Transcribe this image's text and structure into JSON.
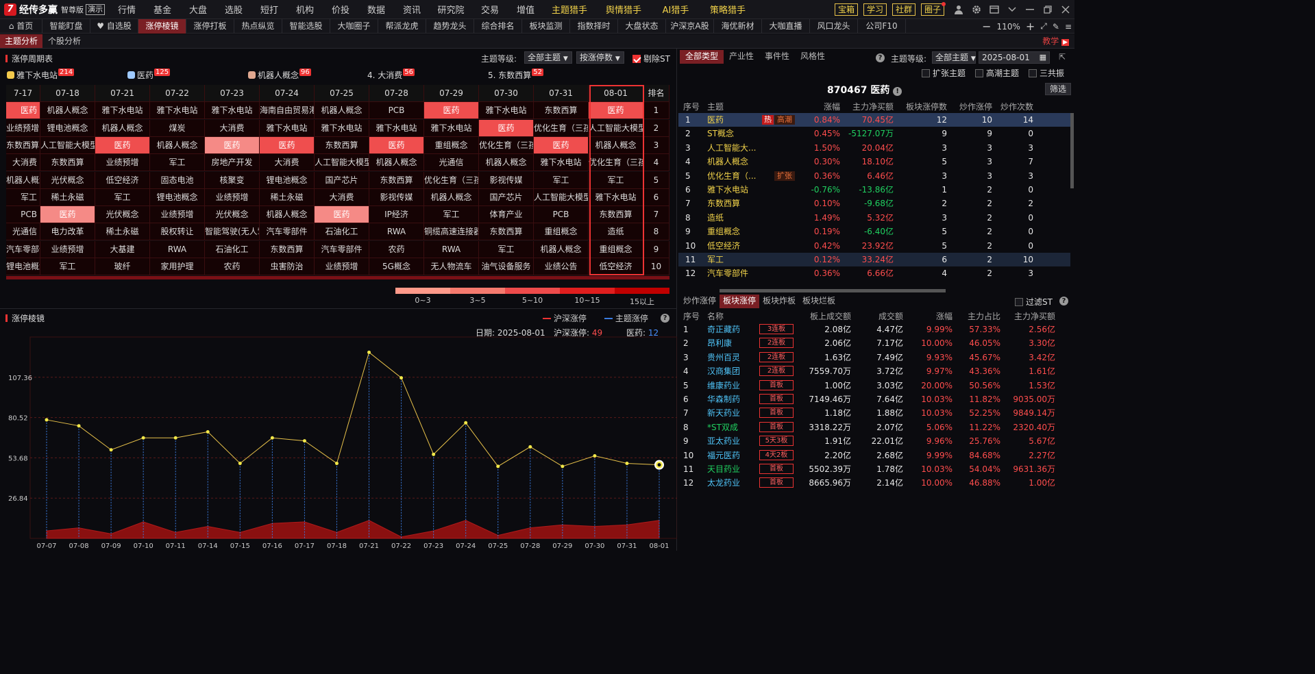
{
  "app": {
    "name": "经传多赢",
    "edition": "智尊版",
    "demo": "演示"
  },
  "menu": [
    {
      "label": "行情",
      "hot": false
    },
    {
      "label": "基金",
      "hot": false
    },
    {
      "label": "大盘",
      "hot": false
    },
    {
      "label": "选股",
      "hot": false
    },
    {
      "label": "短打",
      "hot": false
    },
    {
      "label": "机构",
      "hot": false
    },
    {
      "label": "价投",
      "hot": false
    },
    {
      "label": "数据",
      "hot": false
    },
    {
      "label": "资讯",
      "hot": false
    },
    {
      "label": "研究院",
      "hot": false
    },
    {
      "label": "交易",
      "hot": false
    },
    {
      "label": "增值",
      "hot": false
    },
    {
      "label": "主题猎手",
      "hot": true
    },
    {
      "label": "舆情猎手",
      "hot": true
    },
    {
      "label": "AI猎手",
      "hot": true
    },
    {
      "label": "策略猎手",
      "hot": true
    }
  ],
  "menu_buttons": [
    "宝箱",
    "学习",
    "社群",
    "圈子"
  ],
  "tabs": [
    "首页",
    "智能盯盘",
    "自选股",
    "涨停棱镜",
    "涨停打板",
    "热点纵览",
    "智能选股",
    "大咖圈子",
    "帮派龙虎",
    "趋势龙头",
    "综合排名",
    "板块监测",
    "指数择时",
    "大盘状态",
    "沪深京A股",
    "海优新材",
    "大咖直播",
    "风口龙头",
    "公司F10"
  ],
  "active_tab": "涨停棱镜",
  "zoom": "110%",
  "subtabs": [
    "主题分析",
    "个股分析"
  ],
  "teach": "教学",
  "cycle": {
    "title": "涨停周期表",
    "level_label": "主题等级:",
    "level_value": "全部主题",
    "sort_value": "按涨停数",
    "exclude_st": "剔除ST",
    "topics": [
      {
        "label": "雅下水电站",
        "count": "214",
        "color": "#f2c94c"
      },
      {
        "label": "医药",
        "count": "125",
        "color": "#9ec9ff"
      },
      {
        "label": "机器人概念",
        "count": "96",
        "color": "#e0a890"
      },
      {
        "label": "4. 大消费",
        "count": "56",
        "color": ""
      },
      {
        "label": "5. 东数西算",
        "count": "52",
        "color": ""
      }
    ],
    "dates": [
      "7-17",
      "07-18",
      "07-21",
      "07-22",
      "07-23",
      "07-24",
      "07-25",
      "07-28",
      "07-29",
      "07-30",
      "07-31",
      "08-01"
    ],
    "rank_label": "排名",
    "ranks": [
      "1",
      "2",
      "3",
      "4",
      "5",
      "6",
      "7",
      "8",
      "9",
      "10"
    ],
    "rows": [
      [
        "医药",
        "机器人概念",
        "雅下水电站",
        "雅下水电站",
        "雅下水电站",
        "海南自由贸易港",
        "机器人概念",
        "PCB",
        "医药",
        "雅下水电站",
        "东数西算",
        "医药"
      ],
      [
        "业绩预增",
        "锂电池概念",
        "机器人概念",
        "煤炭",
        "大消费",
        "雅下水电站",
        "雅下水电站",
        "雅下水电站",
        "雅下水电站",
        "医药",
        "优化生育（三孩",
        "人工智能大模型"
      ],
      [
        "东数西算",
        "人工智能大模型",
        "医药",
        "机器人概念",
        "医药",
        "医药",
        "东数西算",
        "医药",
        "重组概念",
        "优化生育（三孩",
        "医药",
        "机器人概念"
      ],
      [
        "大消费",
        "东数西算",
        "业绩预增",
        "军工",
        "房地产开发",
        "大消费",
        "人工智能大模型",
        "机器人概念",
        "光通信",
        "机器人概念",
        "雅下水电站",
        "优化生育（三孩"
      ],
      [
        "机器人概念",
        "光伏概念",
        "低空经济",
        "固态电池",
        "核聚变",
        "锂电池概念",
        "国产芯片",
        "东数西算",
        "优化生育（三孩",
        "影视传媒",
        "军工",
        "军工"
      ],
      [
        "军工",
        "稀土永磁",
        "军工",
        "锂电池概念",
        "业绩预增",
        "稀土永磁",
        "大消费",
        "影视传媒",
        "机器人概念",
        "国产芯片",
        "人工智能大模型",
        "雅下水电站"
      ],
      [
        "PCB",
        "医药",
        "光伏概念",
        "业绩预增",
        "光伏概念",
        "机器人概念",
        "医药",
        "IP经济",
        "军工",
        "体育产业",
        "PCB",
        "东数西算"
      ],
      [
        "光通信",
        "电力改革",
        "稀土永磁",
        "股权转让",
        "智能驾驶(无人驾",
        "汽车零部件",
        "石油化工",
        "RWA",
        "铜缆高速连接器",
        "东数西算",
        "重组概念",
        "造纸"
      ],
      [
        "汽车零部件",
        "业绩预增",
        "大基建",
        "RWA",
        "石油化工",
        "东数西算",
        "汽车零部件",
        "农药",
        "RWA",
        "军工",
        "机器人概念",
        "重组概念"
      ],
      [
        "锂电池概念",
        "军工",
        "玻纤",
        "家用护理",
        "农药",
        "虫害防治",
        "业绩预增",
        "5G概念",
        "无人物流车",
        "油气设备服务",
        "业绩公告",
        "低空经济"
      ]
    ],
    "hl": [
      [
        1,
        0,
        0,
        0,
        0,
        0,
        0,
        0,
        1,
        0,
        0,
        1
      ],
      [
        0,
        0,
        0,
        0,
        0,
        0,
        0,
        0,
        0,
        1,
        0,
        0
      ],
      [
        0,
        0,
        1,
        0,
        2,
        1,
        0,
        1,
        0,
        0,
        1,
        0
      ],
      [
        0,
        0,
        0,
        0,
        0,
        0,
        0,
        0,
        0,
        0,
        0,
        0
      ],
      [
        0,
        0,
        0,
        0,
        0,
        0,
        0,
        0,
        0,
        0,
        0,
        0
      ],
      [
        0,
        0,
        0,
        0,
        0,
        0,
        0,
        0,
        0,
        0,
        0,
        0
      ],
      [
        0,
        2,
        0,
        0,
        0,
        0,
        2,
        0,
        0,
        0,
        0,
        0
      ],
      [
        0,
        0,
        0,
        0,
        0,
        0,
        0,
        0,
        0,
        0,
        0,
        0
      ],
      [
        0,
        0,
        0,
        0,
        0,
        0,
        0,
        0,
        0,
        0,
        0,
        0
      ],
      [
        0,
        0,
        0,
        0,
        0,
        0,
        0,
        0,
        0,
        0,
        0,
        0
      ]
    ],
    "legend": [
      {
        "label": "0~3",
        "color": "#ff9a8a"
      },
      {
        "label": "3~5",
        "color": "#f57a6e"
      },
      {
        "label": "5~10",
        "color": "#ee4b4b"
      },
      {
        "label": "10~15",
        "color": "#e01e1e"
      },
      {
        "label": "15以上",
        "color": "#c00000"
      }
    ]
  },
  "prism": {
    "title": "涨停棱镜",
    "legend": [
      {
        "label": "沪深涨停",
        "color": "#e33"
      },
      {
        "label": "主题涨停",
        "color": "#3a7be0"
      }
    ],
    "info": {
      "date_label": "日期:",
      "date": "2025-08-01",
      "hs_label": "沪深涨停:",
      "hs_value": "49",
      "theme_label": "医药:",
      "theme_value": "12"
    }
  },
  "chart_data": {
    "type": "line",
    "title": "",
    "x": [
      "07-07",
      "07-08",
      "07-09",
      "07-10",
      "07-11",
      "07-14",
      "07-15",
      "07-16",
      "07-17",
      "07-18",
      "07-21",
      "07-22",
      "07-23",
      "07-24",
      "07-25",
      "07-28",
      "07-29",
      "07-30",
      "07-31",
      "08-01"
    ],
    "yticks": [
      "26.84",
      "53.68",
      "80.52",
      "107.36"
    ],
    "ylim": [
      0,
      134.2
    ],
    "series": [
      {
        "name": "沪深涨停",
        "values": [
          79,
          75,
          59,
          67,
          67,
          71,
          50,
          67,
          65,
          50,
          124,
          107,
          56,
          77,
          48,
          61,
          48,
          55,
          50,
          49
        ]
      },
      {
        "name": "主题涨停",
        "values": [
          5,
          7,
          3,
          11,
          4,
          8,
          4,
          10,
          11,
          4,
          12,
          1,
          5,
          12,
          2,
          7,
          9,
          8,
          9,
          12
        ]
      }
    ]
  },
  "right_top": {
    "tabs": [
      "全部类型",
      "产业性",
      "事件性",
      "风格性"
    ],
    "level_label": "主题等级:",
    "level_value": "全部主题",
    "date": "2025-08-01",
    "checks": [
      "扩张主题",
      "高潮主题",
      "三共振"
    ],
    "index_title": "870467 医药",
    "filter_btn": "筛选",
    "headers": [
      "序号",
      "主题",
      "涨幅",
      "主力净买额",
      "板块涨停数",
      "炒作涨停",
      "炒作次数"
    ],
    "rows": [
      {
        "no": "1",
        "name": "医药",
        "hot": "热",
        "tag": "高潮",
        "chg": "0.84%",
        "net": "70.45亿",
        "lu": "12",
        "hype": "10",
        "times": "14",
        "sel": true
      },
      {
        "no": "2",
        "name": "ST概念",
        "hot": "",
        "tag": "",
        "chg": "0.45%",
        "net": "-5127.07万",
        "lu": "9",
        "hype": "9",
        "times": "0",
        "sel": false
      },
      {
        "no": "3",
        "name": "人工智能大...",
        "hot": "",
        "tag": "",
        "chg": "1.50%",
        "net": "20.04亿",
        "lu": "3",
        "hype": "3",
        "times": "3",
        "sel": false
      },
      {
        "no": "4",
        "name": "机器人概念",
        "hot": "",
        "tag": "",
        "chg": "0.30%",
        "net": "18.10亿",
        "lu": "5",
        "hype": "3",
        "times": "7",
        "sel": false
      },
      {
        "no": "5",
        "name": "优化生育（...",
        "hot": "",
        "tag": "扩张",
        "chg": "0.36%",
        "net": "6.46亿",
        "lu": "3",
        "hype": "3",
        "times": "3",
        "sel": false
      },
      {
        "no": "6",
        "name": "雅下水电站",
        "hot": "",
        "tag": "",
        "chg": "-0.76%",
        "net": "-13.86亿",
        "lu": "1",
        "hype": "2",
        "times": "0",
        "sel": false
      },
      {
        "no": "7",
        "name": "东数西算",
        "hot": "",
        "tag": "",
        "chg": "0.10%",
        "net": "-9.68亿",
        "lu": "2",
        "hype": "2",
        "times": "2",
        "sel": false
      },
      {
        "no": "8",
        "name": "造纸",
        "hot": "",
        "tag": "",
        "chg": "1.49%",
        "net": "5.32亿",
        "lu": "3",
        "hype": "2",
        "times": "0",
        "sel": false
      },
      {
        "no": "9",
        "name": "重组概念",
        "hot": "",
        "tag": "",
        "chg": "0.19%",
        "net": "-6.40亿",
        "lu": "5",
        "hype": "2",
        "times": "0",
        "sel": false
      },
      {
        "no": "10",
        "name": "低空经济",
        "hot": "",
        "tag": "",
        "chg": "0.42%",
        "net": "23.92亿",
        "lu": "5",
        "hype": "2",
        "times": "0",
        "sel": false
      },
      {
        "no": "11",
        "name": "军工",
        "hot": "",
        "tag": "",
        "chg": "0.12%",
        "net": "33.24亿",
        "lu": "6",
        "hype": "2",
        "times": "10",
        "sel": true
      },
      {
        "no": "12",
        "name": "汽车零部件",
        "hot": "",
        "tag": "",
        "chg": "0.36%",
        "net": "6.66亿",
        "lu": "4",
        "hype": "2",
        "times": "3",
        "sel": false
      }
    ]
  },
  "right_bottom": {
    "tabs": [
      "炒作涨停",
      "板块涨停",
      "板块炸板",
      "板块烂板"
    ],
    "filter_st": "过滤ST",
    "headers": [
      "序号",
      "名称",
      "板上成交额",
      "成交额",
      "涨幅",
      "主力占比",
      "主力净买额"
    ],
    "rows": [
      {
        "no": "1",
        "name": "奇正藏药",
        "badge": "3连板",
        "amt": "2.08亿",
        "vol": "4.47亿",
        "chg": "9.99%",
        "ratio": "57.33%",
        "net": "2.56亿",
        "green": false
      },
      {
        "no": "2",
        "name": "昂利康",
        "badge": "2连板",
        "amt": "2.06亿",
        "vol": "7.17亿",
        "chg": "10.00%",
        "ratio": "46.05%",
        "net": "3.30亿",
        "green": false
      },
      {
        "no": "3",
        "name": "贵州百灵",
        "badge": "2连板",
        "amt": "1.63亿",
        "vol": "7.49亿",
        "chg": "9.93%",
        "ratio": "45.67%",
        "net": "3.42亿",
        "green": false
      },
      {
        "no": "4",
        "name": "汉商集团",
        "badge": "2连板",
        "amt": "7559.70万",
        "vol": "3.72亿",
        "chg": "9.97%",
        "ratio": "43.36%",
        "net": "1.61亿",
        "green": false
      },
      {
        "no": "5",
        "name": "维康药业",
        "badge": "首板",
        "amt": "1.00亿",
        "vol": "3.03亿",
        "chg": "20.00%",
        "ratio": "50.56%",
        "net": "1.53亿",
        "green": false
      },
      {
        "no": "6",
        "name": "华森制药",
        "badge": "首板",
        "amt": "7149.46万",
        "vol": "7.64亿",
        "chg": "10.03%",
        "ratio": "11.82%",
        "net": "9035.00万",
        "green": false
      },
      {
        "no": "7",
        "name": "新天药业",
        "badge": "首板",
        "amt": "1.18亿",
        "vol": "1.88亿",
        "chg": "10.03%",
        "ratio": "52.25%",
        "net": "9849.14万",
        "green": false
      },
      {
        "no": "8",
        "name": "*ST双成",
        "badge": "首板",
        "amt": "3318.22万",
        "vol": "2.07亿",
        "chg": "5.06%",
        "ratio": "11.22%",
        "net": "2320.40万",
        "green": true
      },
      {
        "no": "9",
        "name": "亚太药业",
        "badge": "5天3板",
        "amt": "1.91亿",
        "vol": "22.01亿",
        "chg": "9.96%",
        "ratio": "25.76%",
        "net": "5.67亿",
        "green": false
      },
      {
        "no": "10",
        "name": "福元医药",
        "badge": "4天2板",
        "amt": "2.20亿",
        "vol": "2.68亿",
        "chg": "9.99%",
        "ratio": "84.68%",
        "net": "2.27亿",
        "green": false
      },
      {
        "no": "11",
        "name": "天目药业",
        "badge": "首板",
        "amt": "5502.39万",
        "vol": "1.78亿",
        "chg": "10.03%",
        "ratio": "54.04%",
        "net": "9631.36万",
        "green": true
      },
      {
        "no": "12",
        "name": "太龙药业",
        "badge": "首板",
        "amt": "8665.96万",
        "vol": "2.14亿",
        "chg": "10.00%",
        "ratio": "46.88%",
        "net": "1.00亿",
        "green": false
      }
    ]
  }
}
